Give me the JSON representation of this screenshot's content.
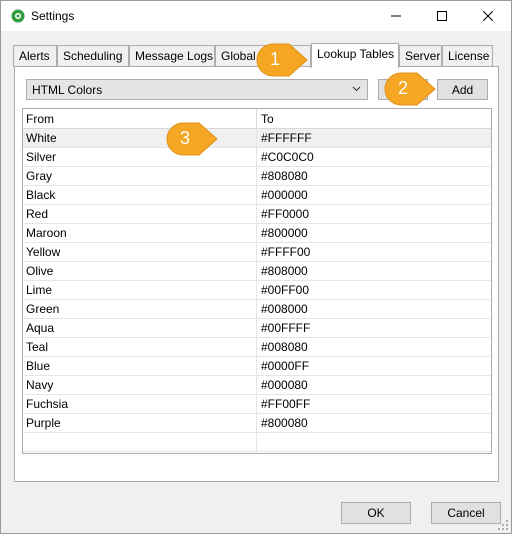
{
  "window": {
    "title": "Settings",
    "icon": "app-gear-icon",
    "accent_color": "#f5a623"
  },
  "tabs": [
    {
      "label": "Alerts",
      "active": false
    },
    {
      "label": "Scheduling",
      "active": false
    },
    {
      "label": "Message Logs",
      "active": false
    },
    {
      "label": "Global I",
      "active": false
    },
    {
      "label": "Lookup Tables",
      "active": true
    },
    {
      "label": "Server",
      "active": false
    },
    {
      "label": "License",
      "active": false
    }
  ],
  "lookup": {
    "selected_table": "HTML Colors",
    "add_label": "Add"
  },
  "grid": {
    "columns": [
      "From",
      "To"
    ],
    "rows": [
      {
        "from": "White",
        "to": "#FFFFFF"
      },
      {
        "from": "Silver",
        "to": "#C0C0C0"
      },
      {
        "from": "Gray",
        "to": "#808080"
      },
      {
        "from": "Black",
        "to": "#000000"
      },
      {
        "from": "Red",
        "to": "#FF0000"
      },
      {
        "from": "Maroon",
        "to": "#800000"
      },
      {
        "from": "Yellow",
        "to": "#FFFF00"
      },
      {
        "from": "Olive",
        "to": "#808000"
      },
      {
        "from": "Lime",
        "to": "#00FF00"
      },
      {
        "from": "Green",
        "to": "#008000"
      },
      {
        "from": "Aqua",
        "to": "#00FFFF"
      },
      {
        "from": "Teal",
        "to": "#008080"
      },
      {
        "from": "Blue",
        "to": "#0000FF"
      },
      {
        "from": "Navy",
        "to": "#000080"
      },
      {
        "from": "Fuchsia",
        "to": "#FF00FF"
      },
      {
        "from": "Purple",
        "to": "#800080"
      }
    ],
    "selected_row": 0
  },
  "callouts": [
    "1",
    "2",
    "3"
  ],
  "footer": {
    "ok_label": "OK",
    "cancel_label": "Cancel"
  }
}
